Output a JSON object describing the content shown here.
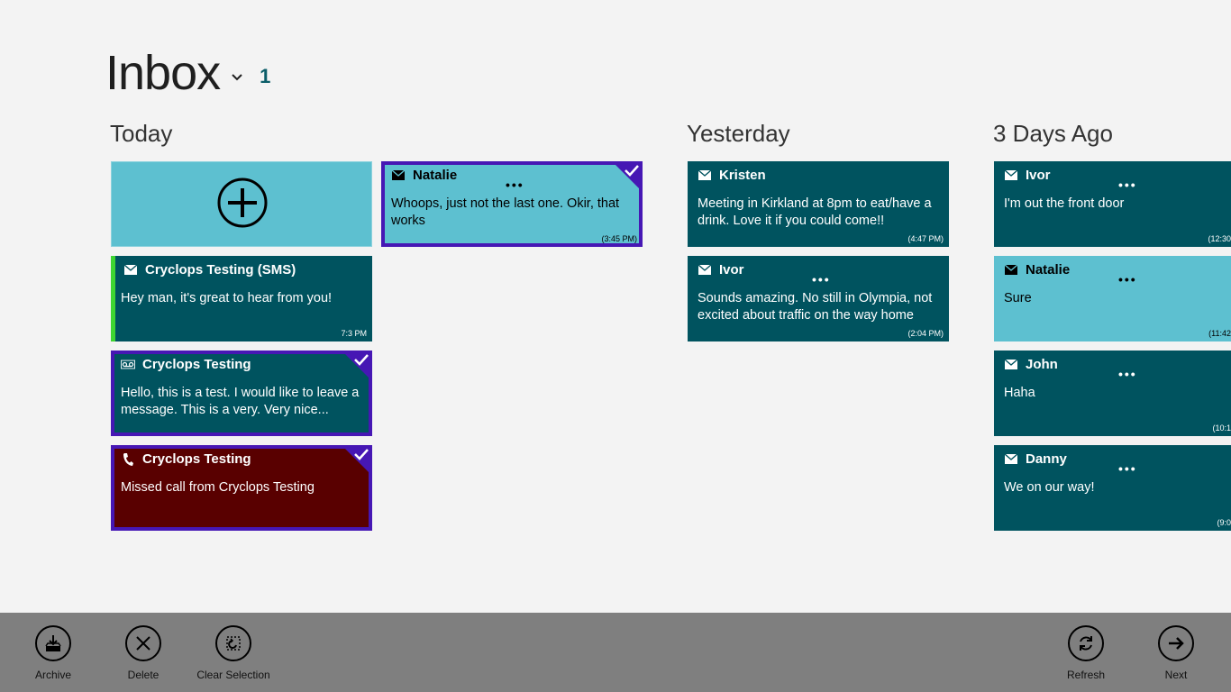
{
  "header": {
    "title": "Inbox",
    "count": "1"
  },
  "groups": {
    "today": "Today",
    "yesterday": "Yesterday",
    "three_days": "3 Days Ago"
  },
  "tiles": {
    "natalie_today": {
      "name": "Natalie",
      "body": "Whoops, just not the last one. Okir, that works",
      "time": "(3:45 PM)",
      "icon": "mail-icon"
    },
    "sms": {
      "name": "Cryclops Testing (SMS)",
      "body": "Hey man, it's great to hear from you!",
      "time": "7:3 PM",
      "icon": "mail-icon"
    },
    "voicemail": {
      "name": "Cryclops Testing",
      "body": "Hello, this is a test. I would like to leave a message. This is a very. Very nice...",
      "icon": "voicemail-icon"
    },
    "missed": {
      "name": "Cryclops Testing",
      "body": "Missed call from Cryclops Testing",
      "icon": "phone-icon"
    },
    "kristen": {
      "name": "Kristen",
      "body": "Meeting in Kirkland at 8pm to eat/have a drink. Love it if you could come!!",
      "time": "(4:47 PM)",
      "icon": "mail-icon"
    },
    "ivor_yest": {
      "name": "Ivor",
      "body": "Sounds amazing. No still in Olympia, not excited about traffic on the way home",
      "time": "(2:04 PM)",
      "icon": "mail-icon"
    },
    "ivor_3d": {
      "name": "Ivor",
      "body": "I'm out the front door",
      "time": "(12:30",
      "icon": "mail-icon"
    },
    "natalie_3d": {
      "name": "Natalie",
      "body": "Sure",
      "time": "(11:42",
      "icon": "mail-icon"
    },
    "john": {
      "name": "John",
      "body": "Haha",
      "time": "(10:1",
      "icon": "mail-icon"
    },
    "danny": {
      "name": "Danny",
      "body": "We on our way!",
      "time": "(9:0",
      "icon": "mail-icon"
    }
  },
  "dots": "•••",
  "appbar": {
    "archive": "Archive",
    "delete": "Delete",
    "clear_selection": "Clear Selection",
    "refresh": "Refresh",
    "next": "Next"
  },
  "colors": {
    "teal": "#00535f",
    "light_teal": "#5dc0d0",
    "maroon": "#590000",
    "selection": "#4617b4",
    "sms_bar": "#3ed531",
    "appbar": "#7f7f7f"
  }
}
